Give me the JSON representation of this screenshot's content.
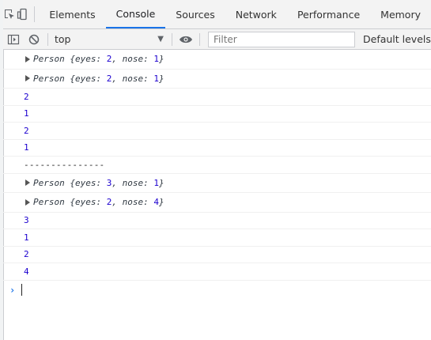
{
  "tabs": {
    "elements": "Elements",
    "console": "Console",
    "sources": "Sources",
    "network": "Network",
    "performance": "Performance",
    "memory": "Memory"
  },
  "toolbar": {
    "context": "top",
    "filter_placeholder": "Filter",
    "levels": "Default levels"
  },
  "messages": [
    {
      "type": "object",
      "class": "Person",
      "k1": "eyes",
      "v1": "2",
      "k2": "nose",
      "v2": "1"
    },
    {
      "type": "object",
      "class": "Person",
      "k1": "eyes",
      "v1": "2",
      "k2": "nose",
      "v2": "1"
    },
    {
      "type": "number",
      "value": "2"
    },
    {
      "type": "number",
      "value": "1"
    },
    {
      "type": "number",
      "value": "2"
    },
    {
      "type": "number",
      "value": "1"
    },
    {
      "type": "text",
      "value": "---------------"
    },
    {
      "type": "object",
      "class": "Person",
      "k1": "eyes",
      "v1": "3",
      "k2": "nose",
      "v2": "1"
    },
    {
      "type": "object",
      "class": "Person",
      "k1": "eyes",
      "v1": "2",
      "k2": "nose",
      "v2": "4"
    },
    {
      "type": "number",
      "value": "3"
    },
    {
      "type": "number",
      "value": "1"
    },
    {
      "type": "number",
      "value": "2"
    },
    {
      "type": "number",
      "value": "4"
    }
  ],
  "colors": {
    "accent": "#1a73e8",
    "number": "#1c00cf"
  }
}
